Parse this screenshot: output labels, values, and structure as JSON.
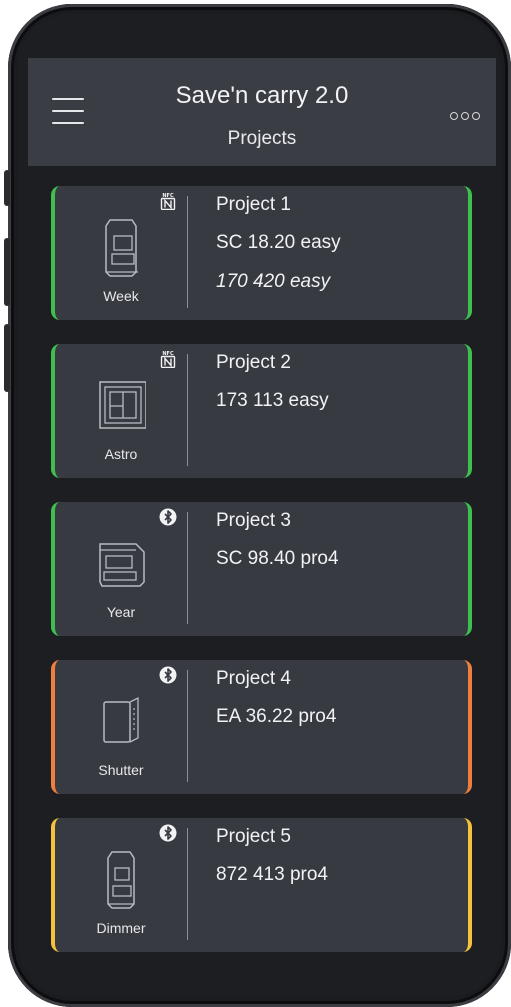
{
  "app": {
    "title": "Save'n carry 2.0",
    "subtitle": "Projects"
  },
  "icons": {
    "menu": "hamburger-menu-icon",
    "more": "more-options-icon",
    "nfc": "nfc-icon",
    "bluetooth": "bluetooth-icon"
  },
  "colors": {
    "status_green": "#3fbf4f",
    "status_orange": "#ef7f3f",
    "status_yellow": "#f4c23c",
    "header_bg": "#3a3d44",
    "card_bg": "#373a41"
  },
  "projects": [
    {
      "name": "Project 1",
      "device_label": "Week",
      "connection": "nfc",
      "status_color": "#3fbf4f",
      "models": [
        "SC 18.20 easy",
        "170 420 easy"
      ]
    },
    {
      "name": "Project 2",
      "device_label": "Astro",
      "connection": "nfc",
      "status_color": "#3fbf4f",
      "models": [
        "173 113 easy"
      ]
    },
    {
      "name": "Project 3",
      "device_label": "Year",
      "connection": "bluetooth",
      "status_color": "#3fbf4f",
      "models": [
        "SC 98.40 pro4"
      ]
    },
    {
      "name": "Project 4",
      "device_label": "Shutter",
      "connection": "bluetooth",
      "status_color": "#ef7f3f",
      "models": [
        "EA 36.22 pro4"
      ]
    },
    {
      "name": "Project 5",
      "device_label": "Dimmer",
      "connection": "bluetooth",
      "status_color": "#f4c23c",
      "models": [
        "872 413 pro4"
      ]
    }
  ]
}
